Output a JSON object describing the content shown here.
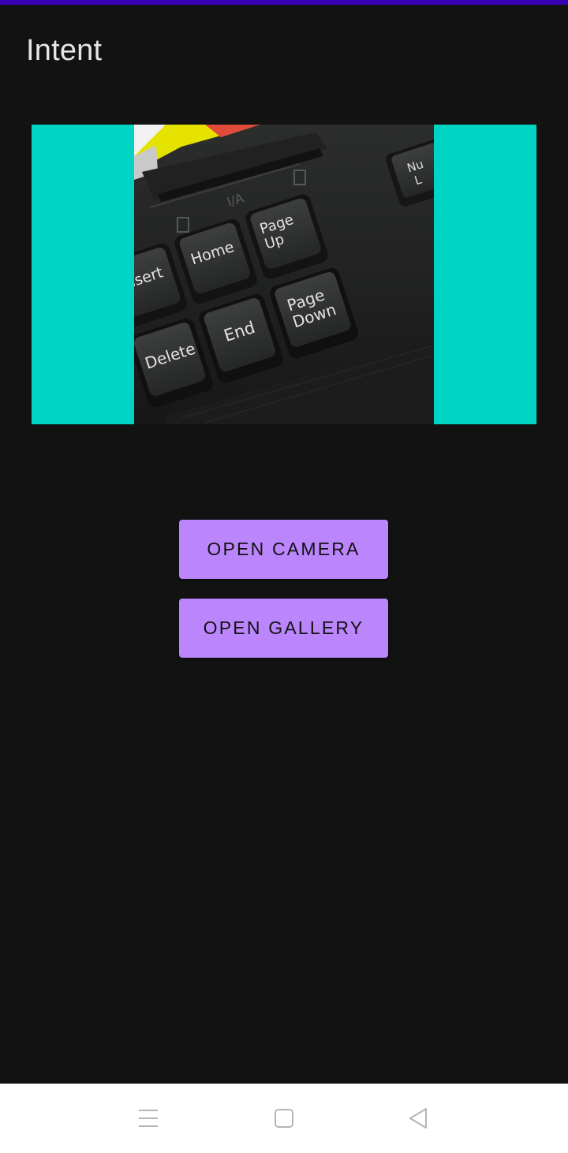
{
  "app_bar": {
    "title": "Intent",
    "status_strip_color": "#3700b3"
  },
  "preview": {
    "background_color": "#00d5c5",
    "photo_key_labels": [
      "Insert",
      "Home",
      "Page Up",
      "Num Lock",
      "Delete",
      "End",
      "Page Down"
    ]
  },
  "actions": {
    "open_camera_label": "OPEN CAMERA",
    "open_gallery_label": "OPEN GALLERY",
    "button_color": "#bb86fc"
  },
  "nav_bar": {
    "icons": [
      "menu-icon",
      "home-square-icon",
      "back-triangle-icon"
    ]
  }
}
